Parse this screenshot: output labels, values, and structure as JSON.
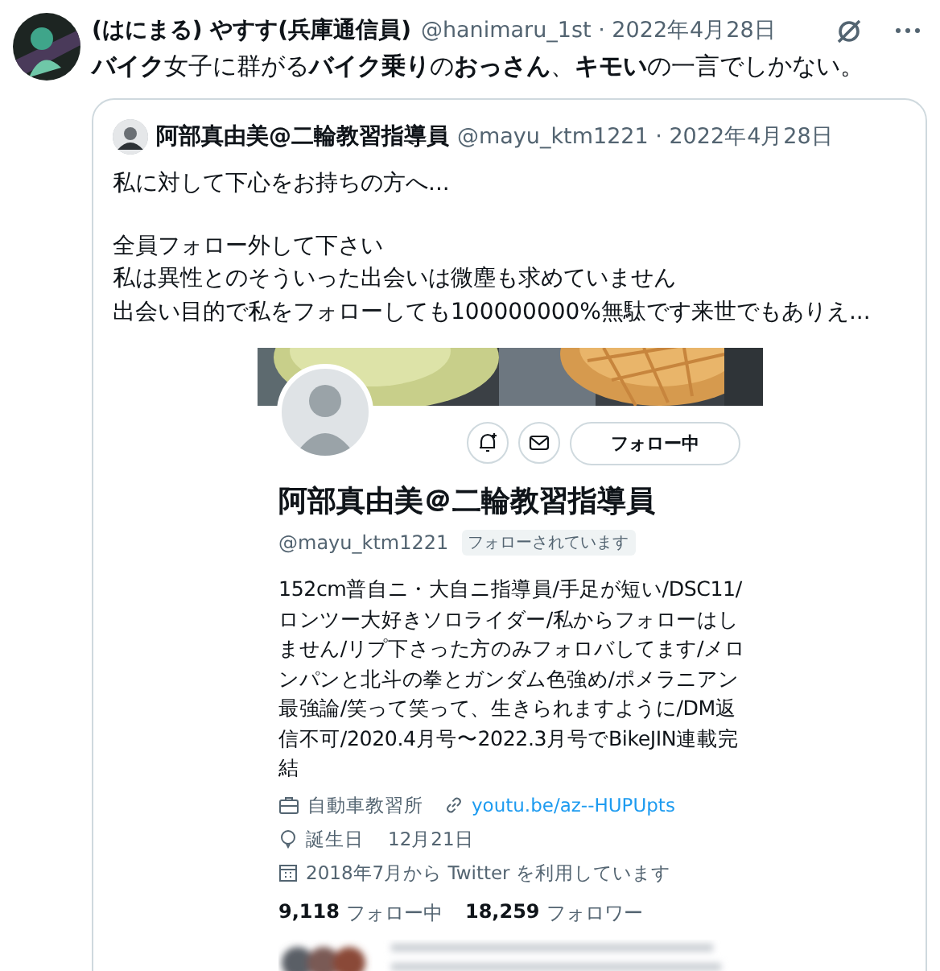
{
  "tweet": {
    "author_name": "(はにまる) やすす(兵庫通信員)",
    "meta": "@hanimaru_1st · 2022年4月28日",
    "text": "**バイク**女子に群がる**バイク乗り**の**おっさん**、**キモい**の一言でしかない。"
  },
  "quote": {
    "author_name": "阿部真由美@二輪教習指導員",
    "meta": "@mayu_ktm1221 · 2022年4月28日",
    "paragraphs": [
      [
        "私に対して下心をお持ちの方へ..."
      ],
      [
        "全員フォロー外して下さい",
        "私は異性とのそういった出会いは微塵も求めていません",
        "出会い目的で私をフォローしても100000000%無駄です来世でもありえ..."
      ]
    ]
  },
  "profile_screenshot": {
    "follow_button": "フォロー中",
    "name": "阿部真由美＠二輪教習指導員",
    "handle": "@mayu_ktm1221",
    "follows_you": "フォローされています",
    "bio": "152cm普自ニ・大自ニ指導員/手足が短い/DSC11/ロンツー大好きソロライダー/私からフォローはしません/リプ下さった方のみフォロバしてます/メロンパンと北斗の拳とガンダム色強め/ポメラニアン最強論/笑って笑って、生きられますように/DM返信不可/2020.4月号〜2022.3月号でBikeJIN連載完結",
    "location": "自動車教習所",
    "link": "youtu.be/az--HUPUpts",
    "birthday_label": "誕生日",
    "birthday": "12月21日",
    "joined": "2018年7月から Twitter を利用しています",
    "following_count": "9,118",
    "following_label": "フォロー中",
    "followers_count": "18,259",
    "followers_label": "フォロワー"
  }
}
